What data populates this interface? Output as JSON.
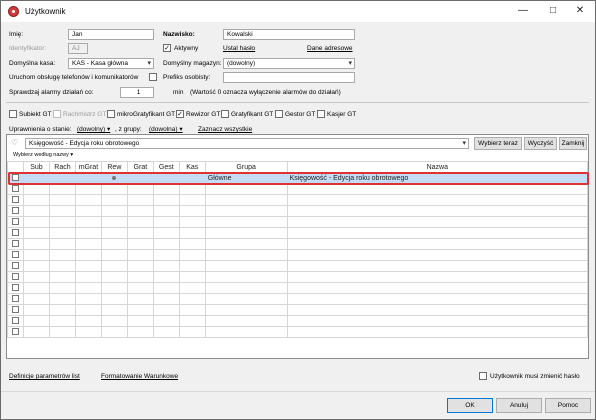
{
  "window": {
    "title": "Użytkownik",
    "min_icon": "minimize-icon",
    "max_icon": "maximize-icon",
    "close_icon": "close-icon"
  },
  "form": {
    "first_name_label": "Imię:",
    "first_name": "Jan",
    "last_name_label": "Nazwisko:",
    "last_name": "Kowalski",
    "identifier_label": "Identyfikator:",
    "identifier": "AJ",
    "active_label": "Aktywny",
    "active": true,
    "set_password_link": "Ustal hasło",
    "address_link": "Dane adresowe",
    "default_cash_label": "Domyślna kasa:",
    "default_cash": "KAS - Kasa główna",
    "default_warehouse_label": "Domyślny magazyn:",
    "default_warehouse": "(dowolny)",
    "phone_label": "Uruchom obsługę telefonów i komunikatorów",
    "prefix_label": "Prefiks osobisty:",
    "prefix": "",
    "alarm_label": "Sprawdzaj alarmy działań co:",
    "alarm_value": "1",
    "alarm_unit": "min",
    "alarm_note": "(Wartość 0 oznacza wyłączenie alarmów do działań)"
  },
  "roles": [
    {
      "label": "Subiekt GT",
      "checked": false,
      "disabled": false
    },
    {
      "label": "Rachmistrz GT",
      "checked": false,
      "disabled": true
    },
    {
      "label": "mikroGratyfikant GT",
      "checked": false,
      "disabled": false
    },
    {
      "label": "Rewizor GT",
      "checked": true,
      "disabled": false
    },
    {
      "label": "Gratyfikant GT",
      "checked": false,
      "disabled": false
    },
    {
      "label": "Gestor GT",
      "checked": false,
      "disabled": false
    },
    {
      "label": "Kasjer GT",
      "checked": false,
      "disabled": false
    }
  ],
  "permissions": {
    "state_label": "Uprawnienia o stanie:",
    "state_value": "(dowolny)",
    "group_label": ", z grupy:",
    "group_value": "(dowolna)",
    "select_all": "Zaznacz wszystkie"
  },
  "filter": {
    "icon": "heart-icon",
    "selected": "Księgowość - Edycja roku obrotowego",
    "choose_now": "Wybierz teraz",
    "clear": "Wyczyść",
    "close": "Zamknij",
    "choose_by": "Wybierz według nazwy"
  },
  "grid": {
    "columns": [
      "",
      "Sub",
      "Rach",
      "mGrat",
      "Rew",
      "Grat",
      "Gest",
      "Kas",
      "Grupa",
      "Nazwa"
    ],
    "rows": [
      {
        "group": "Główne",
        "name": "Księgowość - Edycja roku obrotowego",
        "rew_dot": true
      }
    ],
    "empty_rows": 14
  },
  "footer": {
    "def_link": "Definicje parametrów list",
    "format_link": "Formatowanie Warunkowe",
    "must_change_label": "Użytkownik musi zmienić hasło"
  },
  "buttons": {
    "ok": "OK",
    "cancel": "Anuluj",
    "help": "Pomoc"
  }
}
